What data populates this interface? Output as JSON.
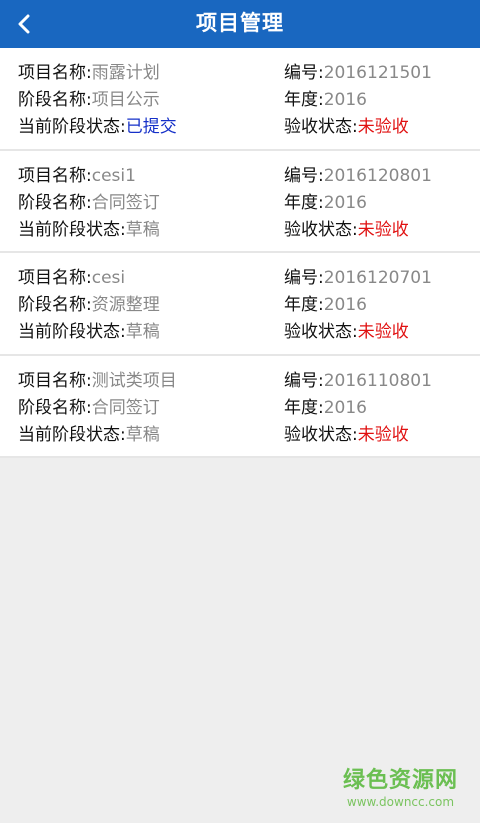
{
  "header": {
    "title": "项目管理",
    "back_icon": "chevron-left-icon"
  },
  "projects": [
    {
      "name_label": "项目名称:",
      "name": "雨露计划",
      "code_label": "编号:",
      "code": "2016121501",
      "stage_label": "阶段名称:",
      "stage": "项目公示",
      "year_label": "年度:",
      "year": "2016",
      "stage_status_label": "当前阶段状态:",
      "stage_status": "已提交",
      "acceptance_label": "验收状态:",
      "acceptance": "未验收"
    },
    {
      "name_label": "项目名称:",
      "name": "cesi1",
      "code_label": "编号:",
      "code": "2016120801",
      "stage_label": "阶段名称:",
      "stage": "合同签订",
      "year_label": "年度:",
      "year": "2016",
      "stage_status_label": "当前阶段状态:",
      "stage_status": "草稿",
      "acceptance_label": "验收状态:",
      "acceptance": "未验收"
    },
    {
      "name_label": "项目名称:",
      "name": "cesi",
      "code_label": "编号:",
      "code": "2016120701",
      "stage_label": "阶段名称:",
      "stage": "资源整理",
      "year_label": "年度:",
      "year": "2016",
      "stage_status_label": "当前阶段状态:",
      "stage_status": "草稿",
      "acceptance_label": "验收状态:",
      "acceptance": "未验收"
    },
    {
      "name_label": "项目名称:",
      "name": "测试类项目",
      "code_label": "编号:",
      "code": "2016110801",
      "stage_label": "阶段名称:",
      "stage": "合同签订",
      "year_label": "年度:",
      "year": "2016",
      "stage_status_label": "当前阶段状态:",
      "stage_status": "草稿",
      "acceptance_label": "验收状态:",
      "acceptance": "未验收"
    }
  ],
  "watermark": {
    "main": "绿色资源网",
    "sub": "www.downcc.com"
  },
  "colors": {
    "header_bg": "#1967c0",
    "submitted": "#1530c8",
    "unaccepted": "#e01010",
    "value_gray": "#888888"
  }
}
